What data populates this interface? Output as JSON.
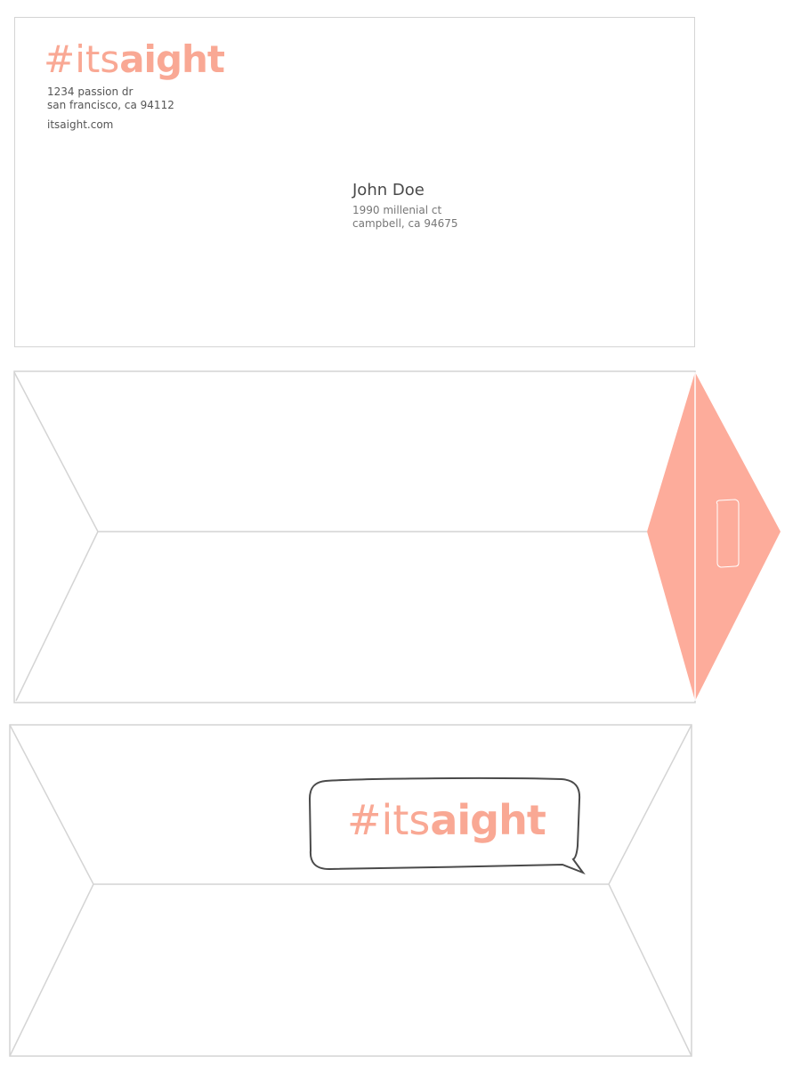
{
  "brand": {
    "logo_prefix": "#its",
    "logo_bold": "aight",
    "accent_color": "#f9a894",
    "outline_color": "#d4d4d4"
  },
  "front": {
    "return_address": {
      "line1": "1234 passion dr",
      "line2": "san francisco, ca 94112",
      "url": "itsaight.com"
    },
    "recipient": {
      "name": "John Doe",
      "line1": "1990 millenial ct",
      "line2": "campbell, ca 94675"
    }
  },
  "back": {
    "speech_bubble_logo_prefix": "#its",
    "speech_bubble_logo_bold": "aight"
  },
  "icons": {
    "seal": "sticker-outline-icon",
    "bubble": "speech-bubble-icon"
  }
}
